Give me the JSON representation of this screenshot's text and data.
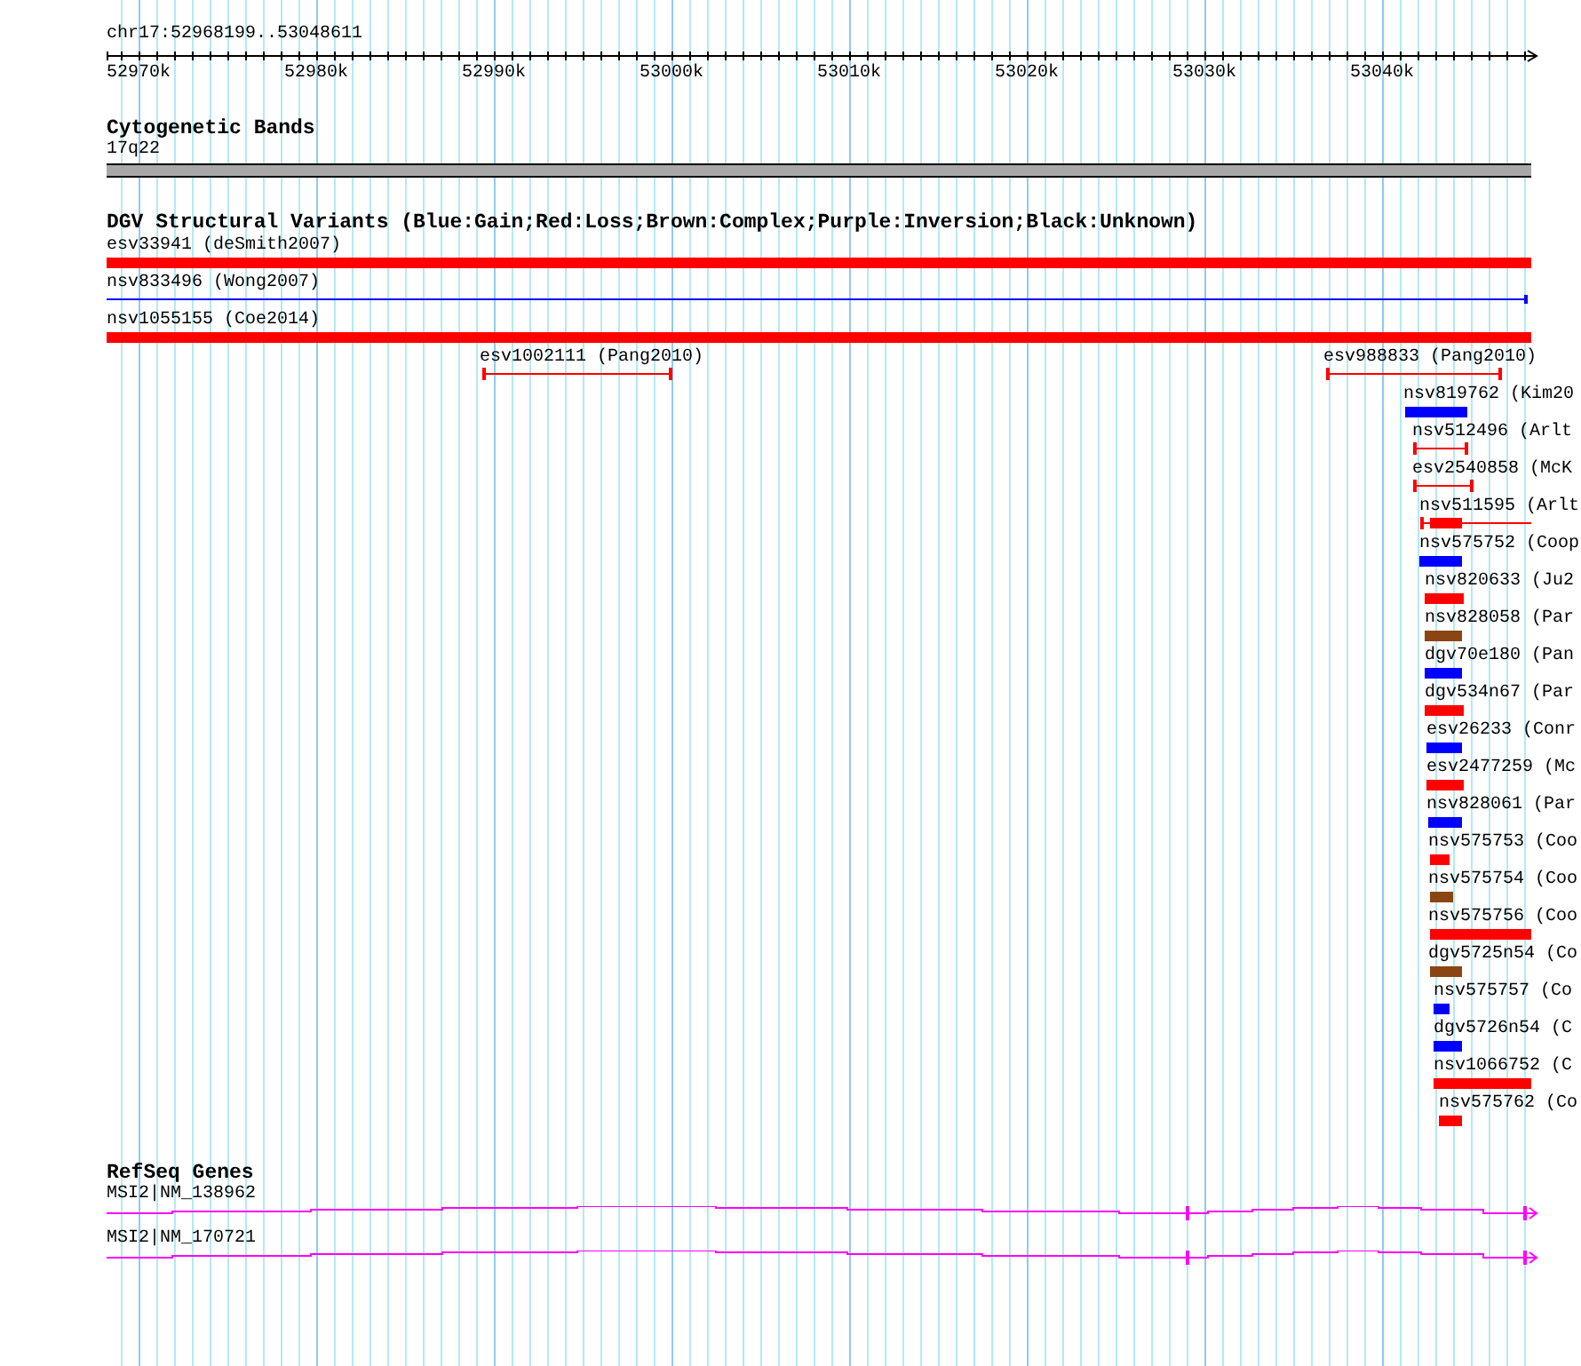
{
  "ruler": {
    "range": "chr17:52968199..53048611",
    "ticks": [
      "52970k",
      "52980k",
      "52990k",
      "53000k",
      "53010k",
      "53020k",
      "53030k",
      "53040k"
    ]
  },
  "cytogenetic_bands": {
    "title": "Cytogenetic Bands",
    "band": "17q22"
  },
  "dgv_track": {
    "title": "DGV Structural Variants (Blue:Gain;Red:Loss;Brown:Complex;Purple:Inversion;Black:Unknown)",
    "rows": [
      {
        "features": [
          {
            "label": "esv33941 (deSmith2007)",
            "kind": "block",
            "color": "#ff0000"
          }
        ]
      },
      {
        "features": [
          {
            "label": "nsv833496 (Wong2007)",
            "kind": "line",
            "color": "#0000ff"
          }
        ]
      },
      {
        "features": [
          {
            "label": "nsv1055155 (Coe2014)",
            "kind": "block",
            "color": "#ff0000"
          }
        ]
      },
      {
        "features": [
          {
            "label": "esv1002111 (Pang2010)",
            "kind": "span",
            "color": "#ff0000"
          },
          {
            "label": "esv988833 (Pang2010)",
            "kind": "span",
            "color": "#ff0000"
          }
        ]
      },
      {
        "features": [
          {
            "label": "nsv819762 (Kim20",
            "kind": "block",
            "color": "#0000ff"
          }
        ]
      },
      {
        "features": [
          {
            "label": "nsv512496 (Arlt",
            "kind": "span",
            "color": "#ff0000"
          }
        ]
      },
      {
        "features": [
          {
            "label": "esv2540858 (McK",
            "kind": "span",
            "color": "#ff0000"
          }
        ]
      },
      {
        "features": [
          {
            "label": "nsv511595 (Arlt",
            "kind": "span_block",
            "color": "#ff0000"
          }
        ]
      },
      {
        "features": [
          {
            "label": "nsv575752 (Coop",
            "kind": "block",
            "color": "#0000ff"
          }
        ]
      },
      {
        "features": [
          {
            "label": "nsv820633 (Ju2",
            "kind": "block",
            "color": "#ff0000"
          }
        ]
      },
      {
        "features": [
          {
            "label": "nsv828058 (Par",
            "kind": "block",
            "color": "#8b4513"
          }
        ]
      },
      {
        "features": [
          {
            "label": "dgv70e180 (Pan",
            "kind": "block",
            "color": "#0000ff"
          }
        ]
      },
      {
        "features": [
          {
            "label": "dgv534n67 (Par",
            "kind": "block",
            "color": "#ff0000"
          }
        ]
      },
      {
        "features": [
          {
            "label": "esv26233 (Conr",
            "kind": "block",
            "color": "#0000ff"
          }
        ]
      },
      {
        "features": [
          {
            "label": "esv2477259 (Mc",
            "kind": "block",
            "color": "#ff0000"
          }
        ]
      },
      {
        "features": [
          {
            "label": "nsv828061 (Par",
            "kind": "block",
            "color": "#0000ff"
          }
        ]
      },
      {
        "features": [
          {
            "label": "nsv575753 (Coo",
            "kind": "block",
            "color": "#ff0000"
          }
        ]
      },
      {
        "features": [
          {
            "label": "nsv575754 (Coo",
            "kind": "block",
            "color": "#8b4513"
          }
        ]
      },
      {
        "features": [
          {
            "label": "nsv575756 (Coo",
            "kind": "block",
            "color": "#ff0000"
          }
        ]
      },
      {
        "features": [
          {
            "label": "dgv5725n54 (Co",
            "kind": "block",
            "color": "#8b4513"
          }
        ]
      },
      {
        "features": [
          {
            "label": "nsv575757 (Co",
            "kind": "block",
            "color": "#0000ff"
          }
        ]
      },
      {
        "features": [
          {
            "label": "dgv5726n54 (C",
            "kind": "block",
            "color": "#0000ff"
          }
        ]
      },
      {
        "features": [
          {
            "label": "nsv1066752 (C",
            "kind": "block",
            "color": "#ff0000"
          }
        ]
      },
      {
        "features": [
          {
            "label": "nsv575762 (Co",
            "kind": "block",
            "color": "#ff0000"
          }
        ]
      }
    ]
  },
  "refseq_genes": {
    "title": "RefSeq Genes",
    "genes": [
      {
        "label": "MSI2|NM_138962"
      },
      {
        "label": "MSI2|NM_170721"
      }
    ]
  }
}
